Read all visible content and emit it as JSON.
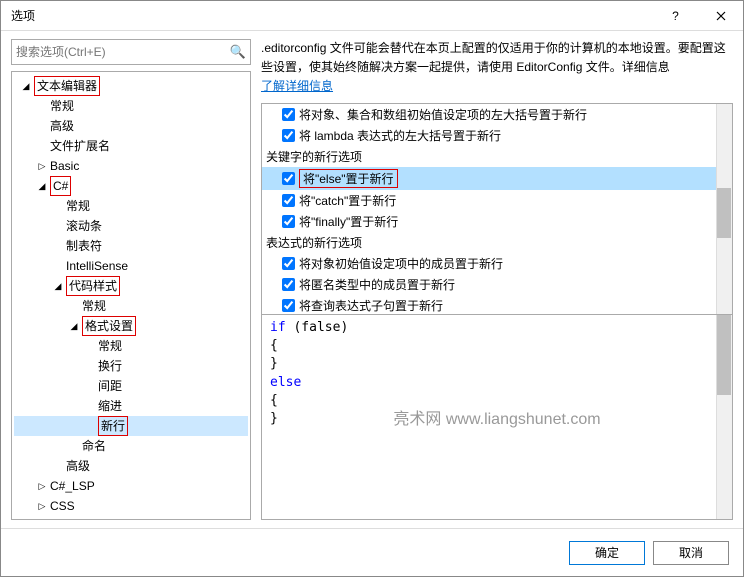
{
  "title": "选项",
  "search": {
    "placeholder": "搜索选项(Ctrl+E)"
  },
  "tree": [
    {
      "label": "文本编辑器",
      "level": 0,
      "expandable": true,
      "expanded": true,
      "hl": true
    },
    {
      "label": "常规",
      "level": 1,
      "expandable": false
    },
    {
      "label": "高级",
      "level": 1,
      "expandable": false
    },
    {
      "label": "文件扩展名",
      "level": 1,
      "expandable": false
    },
    {
      "label": "Basic",
      "level": 1,
      "expandable": true,
      "expanded": false
    },
    {
      "label": "C#",
      "level": 1,
      "expandable": true,
      "expanded": true,
      "hl": true
    },
    {
      "label": "常规",
      "level": 2,
      "expandable": false
    },
    {
      "label": "滚动条",
      "level": 2,
      "expandable": false
    },
    {
      "label": "制表符",
      "level": 2,
      "expandable": false
    },
    {
      "label": "IntelliSense",
      "level": 2,
      "expandable": false
    },
    {
      "label": "代码样式",
      "level": 2,
      "expandable": true,
      "expanded": true,
      "hl": true
    },
    {
      "label": "常规",
      "level": 3,
      "expandable": false
    },
    {
      "label": "格式设置",
      "level": 3,
      "expandable": true,
      "expanded": true,
      "hl": true
    },
    {
      "label": "常规",
      "level": 4,
      "expandable": false
    },
    {
      "label": "换行",
      "level": 4,
      "expandable": false
    },
    {
      "label": "间距",
      "level": 4,
      "expandable": false
    },
    {
      "label": "缩进",
      "level": 4,
      "expandable": false
    },
    {
      "label": "新行",
      "level": 4,
      "expandable": false,
      "hl": true,
      "selected": true
    },
    {
      "label": "命名",
      "level": 3,
      "expandable": false
    },
    {
      "label": "高级",
      "level": 2,
      "expandable": false
    },
    {
      "label": "C#_LSP",
      "level": 1,
      "expandable": true,
      "expanded": false
    },
    {
      "label": "CSS",
      "level": 1,
      "expandable": true,
      "expanded": false
    }
  ],
  "info": {
    "text": ".editorconfig 文件可能会替代在本页上配置的仅适用于你的计算机的本地设置。要配置这些设置，使其始终随解决方案一起提供，请使用 EditorConfig 文件。详细信息",
    "link": "了解详细信息"
  },
  "options": [
    {
      "type": "item",
      "label": "将对象、集合和数组初始值设定项的左大括号置于新行",
      "checked": true
    },
    {
      "type": "item",
      "label": "将 lambda 表达式的左大括号置于新行",
      "checked": true
    },
    {
      "type": "header",
      "label": "关键字的新行选项"
    },
    {
      "type": "item",
      "label": "将\"else\"置于新行",
      "checked": true,
      "selected": true,
      "hl": true
    },
    {
      "type": "item",
      "label": "将\"catch\"置于新行",
      "checked": true
    },
    {
      "type": "item",
      "label": "将\"finally\"置于新行",
      "checked": true
    },
    {
      "type": "header",
      "label": "表达式的新行选项"
    },
    {
      "type": "item",
      "label": "将对象初始值设定项中的成员置于新行",
      "checked": true
    },
    {
      "type": "item",
      "label": "将匿名类型中的成员置于新行",
      "checked": true
    },
    {
      "type": "item",
      "label": "将查询表达式子句置于新行",
      "checked": true
    }
  ],
  "code": {
    "line1_kw": "if",
    "line1_rest": " (false)",
    "line2": "{",
    "line3": "}",
    "line4_kw": "else",
    "line5": "{",
    "line6": "}"
  },
  "watermark": "亮术网 www.liangshunet.com",
  "buttons": {
    "ok": "确定",
    "cancel": "取消"
  }
}
